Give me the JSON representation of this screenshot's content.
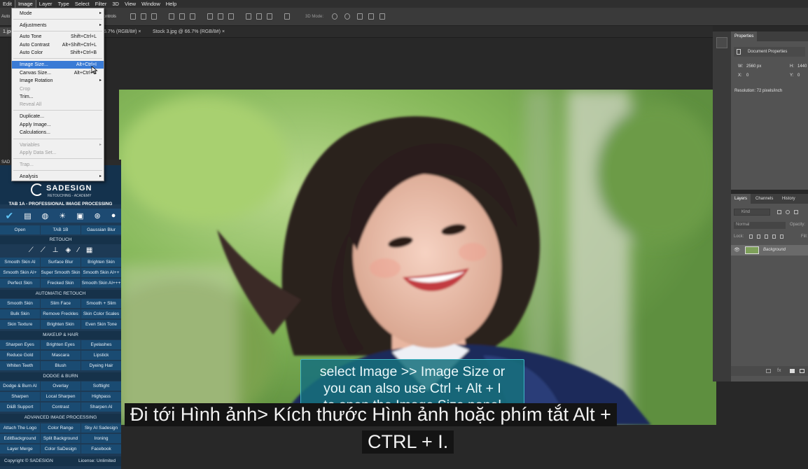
{
  "menubar": {
    "items": [
      "Edit",
      "Image",
      "Layer",
      "Type",
      "Select",
      "Filter",
      "3D",
      "View",
      "Window",
      "Help"
    ]
  },
  "options": {
    "auto_label": "Auto",
    "controls_label": "ontrols",
    "mode_label": "3D Mode:"
  },
  "tabs": [
    {
      "label": "1.jpg",
      "close": ""
    },
    {
      "label": "6.7% (RGB/8#)",
      "close": "×"
    },
    {
      "label": "Stock 3.jpg @ 66.7% (RGB/8#)",
      "close": "×"
    }
  ],
  "image_menu": {
    "items": [
      {
        "label": "Mode",
        "shortcut": "",
        "arrow": "▸",
        "state": "normal"
      },
      {
        "label": "Adjustments",
        "shortcut": "",
        "arrow": "▸",
        "state": "normal"
      },
      {
        "label": "Auto Tone",
        "shortcut": "Shift+Ctrl+L",
        "arrow": "",
        "state": "normal"
      },
      {
        "label": "Auto Contrast",
        "shortcut": "Alt+Shift+Ctrl+L",
        "arrow": "",
        "state": "normal"
      },
      {
        "label": "Auto Color",
        "shortcut": "Shift+Ctrl+B",
        "arrow": "",
        "state": "normal"
      },
      {
        "label": "Image Size...",
        "shortcut": "Alt+Ctrl+I",
        "arrow": "",
        "state": "highlighted"
      },
      {
        "label": "Canvas Size...",
        "shortcut": "Alt+Ctrl+C",
        "arrow": "",
        "state": "normal"
      },
      {
        "label": "Image Rotation",
        "shortcut": "",
        "arrow": "▸",
        "state": "normal"
      },
      {
        "label": "Crop",
        "shortcut": "",
        "arrow": "",
        "state": "disabled"
      },
      {
        "label": "Trim...",
        "shortcut": "",
        "arrow": "",
        "state": "normal"
      },
      {
        "label": "Reveal All",
        "shortcut": "",
        "arrow": "",
        "state": "disabled"
      },
      {
        "label": "Duplicate...",
        "shortcut": "",
        "arrow": "",
        "state": "normal"
      },
      {
        "label": "Apply Image...",
        "shortcut": "",
        "arrow": "",
        "state": "normal"
      },
      {
        "label": "Calculations...",
        "shortcut": "",
        "arrow": "",
        "state": "normal"
      },
      {
        "label": "Variables",
        "shortcut": "",
        "arrow": "▸",
        "state": "disabled"
      },
      {
        "label": "Apply Data Set...",
        "shortcut": "",
        "arrow": "",
        "state": "disabled"
      },
      {
        "label": "Trap...",
        "shortcut": "",
        "arrow": "",
        "state": "disabled"
      },
      {
        "label": "Analysis",
        "shortcut": "",
        "arrow": "▸",
        "state": "normal"
      }
    ]
  },
  "sadesign": {
    "panel_title": "SAD",
    "logo_text": "SADESIGN",
    "logo_sub": "RETOUCHING - ACADEMY",
    "tab_title": "TAB 1A - PROFESSIONAL IMAGE PROCESSING",
    "top_row": [
      "Open",
      "TAB 1B",
      "Gaussian Blur"
    ],
    "sections": {
      "retouch": "RETOUCH",
      "auto": "AUTOMATIC RETOUCH",
      "makeup": "MAKEUP & HAIR",
      "dodge": "DODGE & BURN",
      "advanced": "ADVANCED IMAGE PROCESSING"
    },
    "retouch_rows": [
      [
        "Smooth Skin AI",
        "Surface Blur",
        "Brighten Skin"
      ],
      [
        "Smooth Skin AI+",
        "Super Smooth Skin",
        "Smooth Skin AI++"
      ],
      [
        "Perfect Skin",
        "Frecked Skin",
        "Smooth Skin AI+++"
      ]
    ],
    "auto_rows": [
      [
        "Smooth Skin",
        "Slim Face",
        "Smooth + Slim"
      ],
      [
        "Bulk Skin",
        "Remove Freckles",
        "Skin Color Scales"
      ],
      [
        "Skin Texture",
        "Brighten Skin",
        "Even Skin Tone"
      ]
    ],
    "makeup_rows": [
      [
        "Sharpen Eyes",
        "Brighten Eyes",
        "Eyelashes"
      ],
      [
        "Reduce Gold",
        "Mascara",
        "Lipstick"
      ],
      [
        "Whiten Teeth",
        "Blush",
        "Dyeing Hair"
      ]
    ],
    "dodge_rows": [
      [
        "Dodge & Burn AI",
        "Overlay",
        "Softlight"
      ],
      [
        "Sharpen",
        "Local Sharpen",
        "Highpass"
      ],
      [
        "D&B Support",
        "Contrast",
        "Sharpen AI"
      ]
    ],
    "advanced_rows": [
      [
        "Attach The Logo",
        "Color Range",
        "Sky AI Sadesign"
      ],
      [
        "EditBackground",
        "Split Background",
        "Ironing"
      ],
      [
        "Layer Merge",
        "Color SaDesign",
        "Facebook"
      ]
    ],
    "footer_left": "Copyright © SADESIGN",
    "footer_right": "License: Unlimited"
  },
  "properties": {
    "tab": "Properties",
    "title": "Document Properties",
    "w_label": "W:",
    "w_value": "2560 px",
    "h_label": "H:",
    "h_value": "1440",
    "x_label": "X:",
    "x_value": "0",
    "y_label": "Y:",
    "y_value": "0",
    "resolution": "Resolution: 72 pixels/inch"
  },
  "layers": {
    "tabs": [
      "Layers",
      "Channels",
      "History"
    ],
    "kind": "Kind",
    "blend": "Normal",
    "opacity": "Opacity:",
    "lock": "Lock:",
    "fill": "Fill:",
    "layer_name": "Background"
  },
  "tooltip": {
    "line1": "select Image >> Image Size or",
    "line2": "you can also use Ctrl + Alt + I",
    "line3": "to open the Image Size panel"
  },
  "subtitle": {
    "line1": "Đi tới Hình ảnh> Kích thước Hình ảnh hoặc phím tắt Alt +",
    "line2": "CTRL + I."
  },
  "colors": {
    "menu_highlight": "#3a7bd5",
    "sadesign_blue": "#1a4b72",
    "tooltip_bg": "#16707d"
  }
}
